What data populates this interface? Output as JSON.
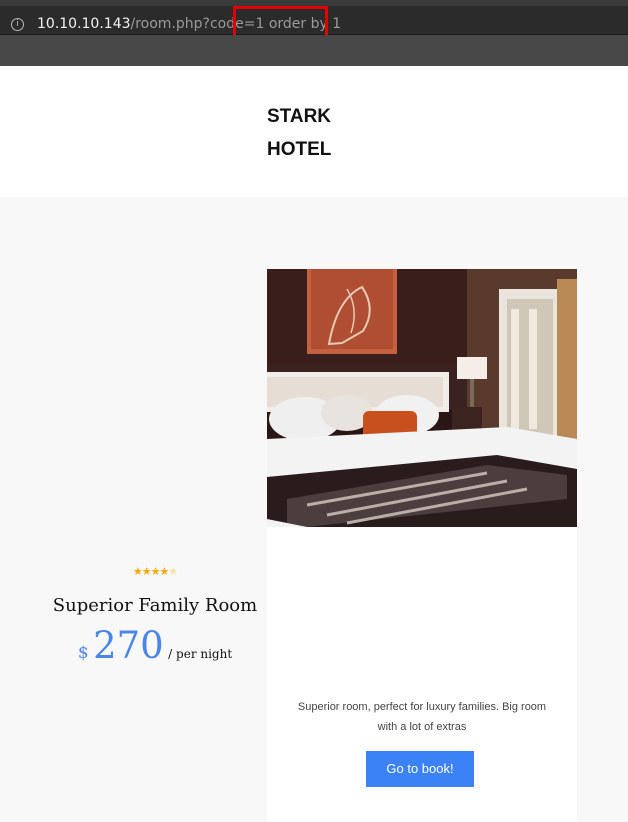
{
  "browser": {
    "url_host": "10.10.10.143",
    "url_path": "/room.php?code=1 order by 1",
    "info_icon": "info-circle-icon"
  },
  "header": {
    "brand_line1": "STARK",
    "brand_line2": "HOTEL"
  },
  "room": {
    "rating": 4,
    "rating_max": 5,
    "name": "Superior Family Room",
    "currency": "$",
    "price": "270",
    "price_unit": "/ per night",
    "description": "Superior room, perfect for luxury families. Big room with a lot of extras",
    "button_label": "Go to book!"
  },
  "colors": {
    "accent": "#3b82f6",
    "star": "#f2a900",
    "highlight_box": "#e00000"
  }
}
